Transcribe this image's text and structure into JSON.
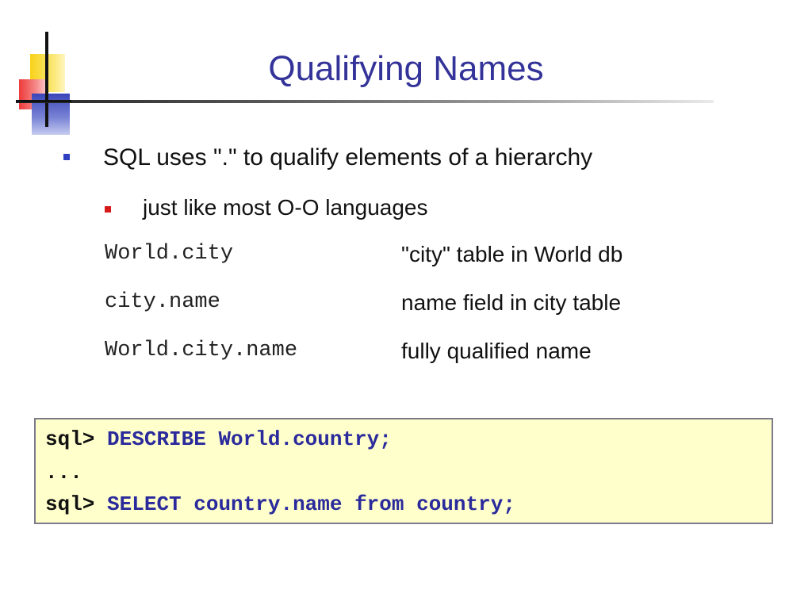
{
  "slide": {
    "title": "Qualifying Names",
    "bullets": [
      {
        "text": "SQL uses \".\" to qualify elements of a hierarchy"
      },
      {
        "text": "just like most O-O languages"
      }
    ],
    "qualified_names": [
      {
        "code": "World.city",
        "description": "\"city\" table in World db"
      },
      {
        "code": "city.name",
        "description": "name field in city table"
      },
      {
        "code": "World.city.name",
        "description": "fully qualified name"
      }
    ],
    "code_block": {
      "lines": [
        {
          "prompt": "sql>",
          "command": "DESCRIBE World.country;"
        },
        {
          "prompt": "...",
          "command": ""
        },
        {
          "prompt": "sql>",
          "command": "SELECT country.name from country;"
        }
      ]
    },
    "colors": {
      "title": "#333399",
      "bullet_level1": "#2f3fbf",
      "bullet_level2": "#d61a1a",
      "code_bg": "#ffffcc",
      "code_command": "#2a2a9c"
    },
    "icons": {
      "logo": "color-squares-logo-icon",
      "bullet1": "square-bullet-icon",
      "bullet2": "square-bullet-icon"
    }
  }
}
